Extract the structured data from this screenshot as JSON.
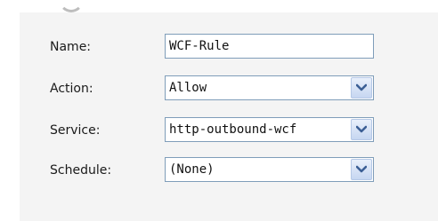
{
  "form": {
    "name": {
      "label": "Name:",
      "value": "WCF-Rule"
    },
    "action": {
      "label": "Action:",
      "selected": "Allow"
    },
    "service": {
      "label": "Service:",
      "selected": "http-outbound-wcf"
    },
    "schedule": {
      "label": "Schedule:",
      "selected": "(None)"
    }
  },
  "colors": {
    "panel_background": "#f4f4f4",
    "field_border": "#7f9db9",
    "dropdown_arrow": "#3c5f95"
  },
  "icons": {
    "dropdown": "chevron-down-icon"
  }
}
